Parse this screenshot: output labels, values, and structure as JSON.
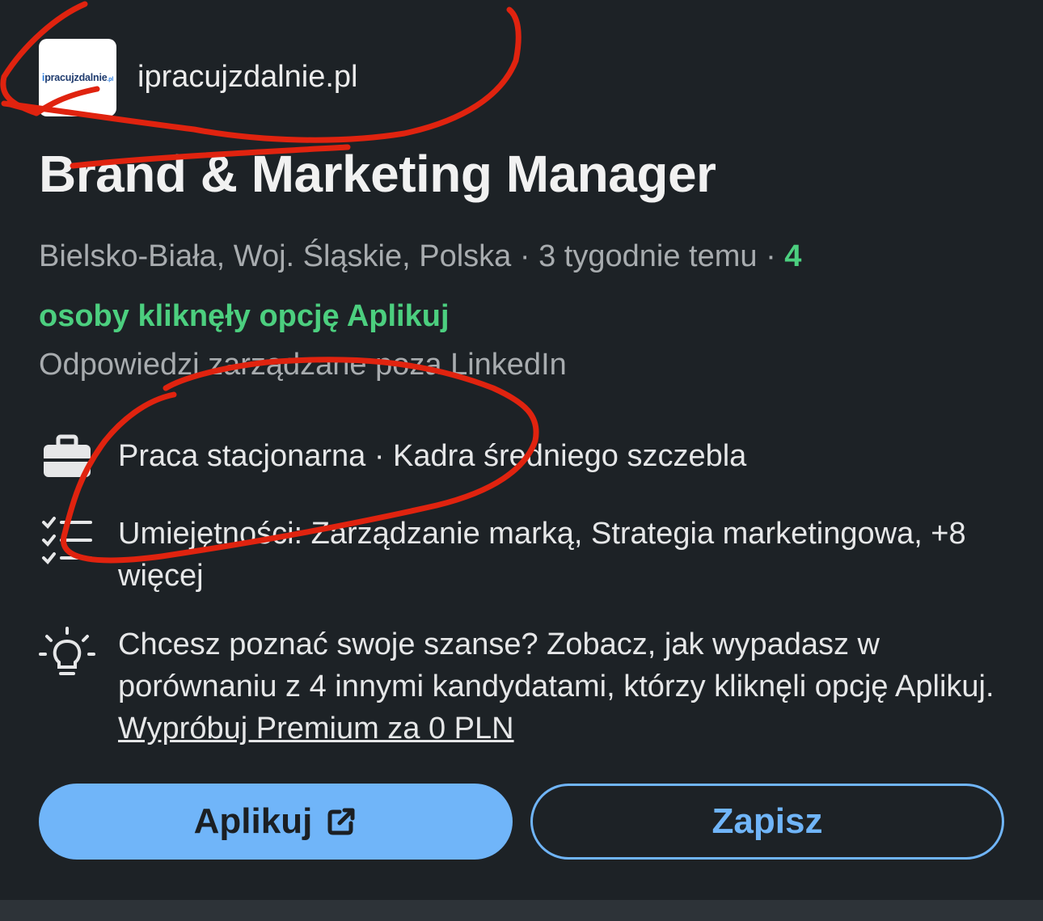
{
  "company": {
    "logo_text_main": "pracujzdalnie",
    "logo_text_prefix": "i",
    "logo_text_suffix": ".pl",
    "name": "ipracujzdalnie.pl"
  },
  "job": {
    "title": "Brand & Marketing Manager",
    "location": "Bielsko-Biała, Woj. Śląskie, Polska",
    "posted": "3 tygodnie temu",
    "separator": "·",
    "applicants_count": "4",
    "applicants_text": "osoby kliknęły opcję Aplikuj",
    "offsite_note": "Odpowiedzi zarządzane poza LinkedIn"
  },
  "details": {
    "workplace": "Praca stacjonarna · Kadra średniego szczebla",
    "skills": "Umiejętności: Zarządzanie marką, Strategia marketingowa, +8 więcej",
    "insight_text": "Chcesz poznać swoje szanse? Zobacz, jak wypadasz w porównaniu z 4 innymi kandydatami, którzy kliknęli opcję Aplikuj. ",
    "premium_link": "Wypróbuj Premium za 0 PLN"
  },
  "actions": {
    "apply_label": "Aplikuj",
    "save_label": "Zapisz"
  },
  "icons": {
    "briefcase": "briefcase-icon",
    "skills": "checklist-icon",
    "insight": "lightbulb-icon",
    "external": "external-link-icon"
  },
  "colors": {
    "background": "#1d2226",
    "accent_blue": "#70b5f9",
    "green": "#4ccf7f",
    "annotation_red": "#e0230f"
  }
}
